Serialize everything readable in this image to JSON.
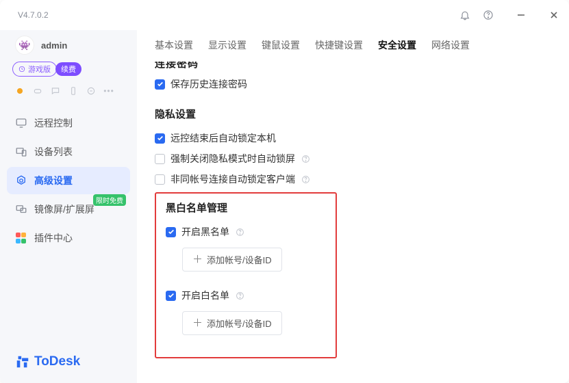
{
  "version": "V4.7.0.2",
  "user": {
    "name": "admin"
  },
  "plan": {
    "label": "游戏版",
    "renew": "续费"
  },
  "sidebar": {
    "items": [
      {
        "label": "远程控制"
      },
      {
        "label": "设备列表"
      },
      {
        "label": "高级设置"
      },
      {
        "label": "镜像屏/扩展屏",
        "badge": "限时免费"
      },
      {
        "label": "插件中心"
      }
    ]
  },
  "brand": "ToDesk",
  "tabs": [
    "基本设置",
    "显示设置",
    "键鼠设置",
    "快捷键设置",
    "安全设置",
    "网络设置"
  ],
  "sections": {
    "truncated_heading": "连接密码",
    "save_history_pwd": "保存历史连接密码",
    "privacy_heading": "隐私设置",
    "lock_after_remote": "远控结束后自动锁定本机",
    "force_lock_privacy": "强制关闭隐私模式时自动锁屏",
    "diff_account_lock": "非同帐号连接自动锁定客户端",
    "list_mgmt_heading": "黑白名单管理",
    "enable_blacklist": "开启黑名单",
    "add_blacklist": "添加帐号/设备ID",
    "enable_whitelist": "开启白名单",
    "add_whitelist": "添加帐号/设备ID"
  }
}
